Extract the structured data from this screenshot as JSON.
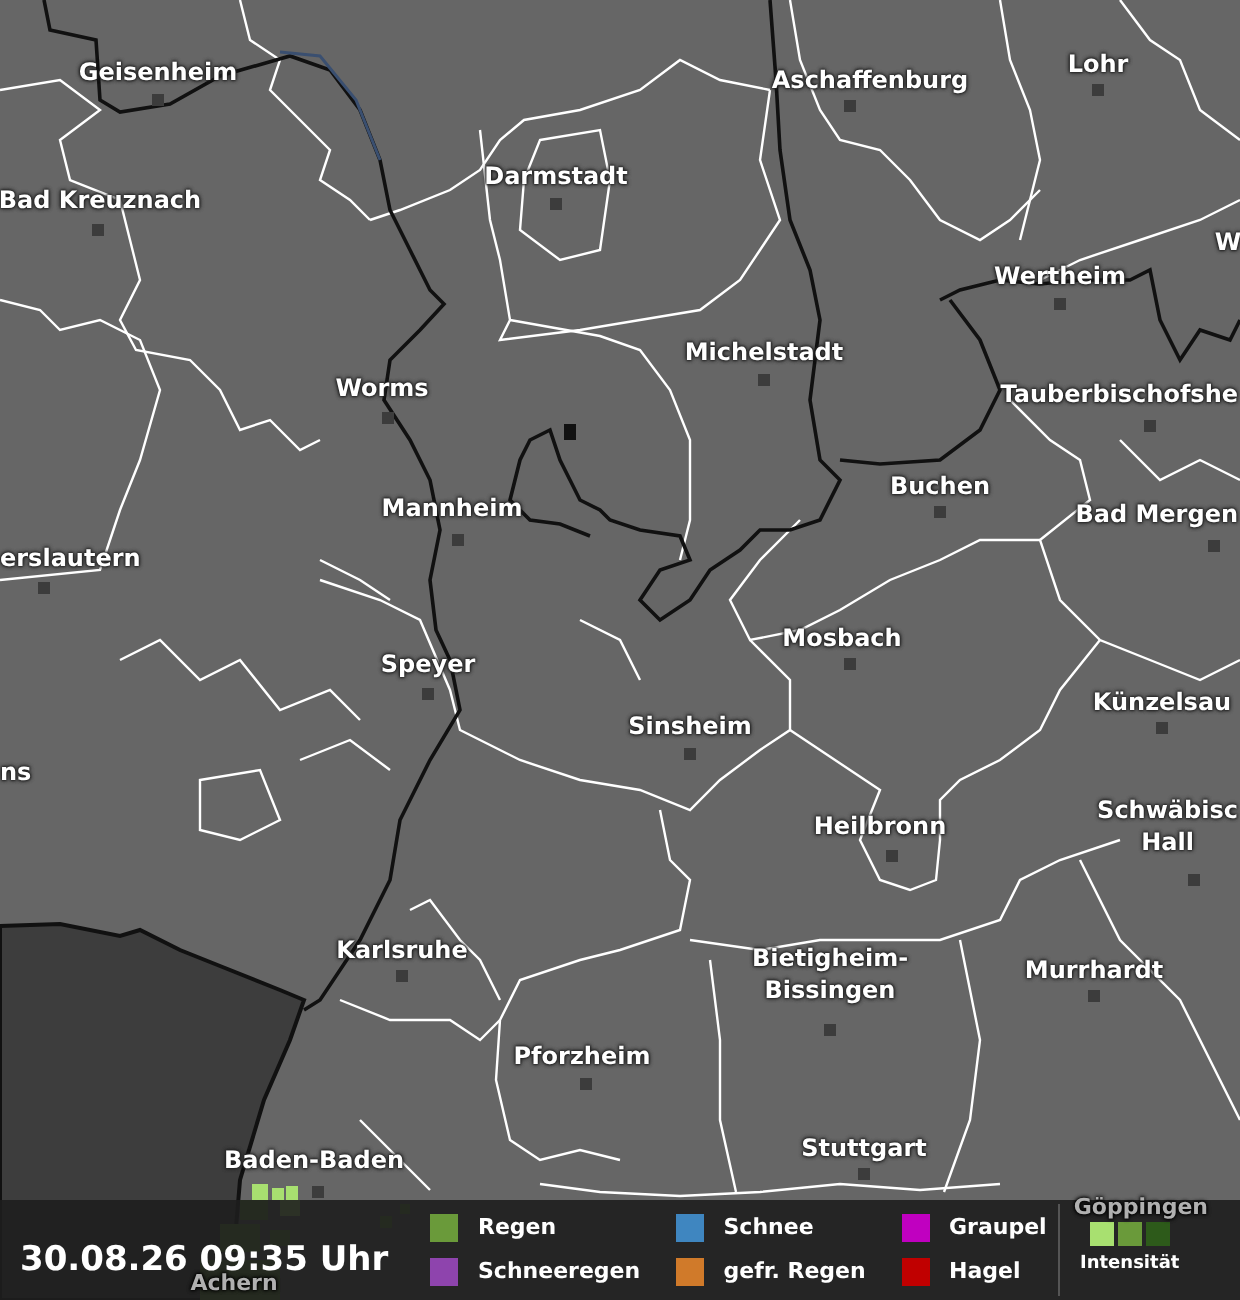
{
  "map": {
    "cities": [
      {
        "name": "Geisenheim"
      },
      {
        "name": "Bad Kreuznach"
      },
      {
        "name": "Darmstadt"
      },
      {
        "name": "Aschaffenburg"
      },
      {
        "name": "Lohr"
      },
      {
        "name": "W"
      },
      {
        "name": "Wertheim"
      },
      {
        "name": "Michelstadt"
      },
      {
        "name": "Worms"
      },
      {
        "name": "Tauberbischofshe"
      },
      {
        "name": "erslautern"
      },
      {
        "name": "Mannheim"
      },
      {
        "name": "Buchen"
      },
      {
        "name": "Bad Mergen"
      },
      {
        "name": "Mosbach"
      },
      {
        "name": "Speyer"
      },
      {
        "name": "Künzelsau"
      },
      {
        "name": "Sinsheim"
      },
      {
        "name": "ns"
      },
      {
        "name": "Heilbronn"
      },
      {
        "name": "Schwäbisc Hall"
      },
      {
        "name": "Karlsruhe"
      },
      {
        "name": "Bietigheim- Bissingen"
      },
      {
        "name": "Murrhardt"
      },
      {
        "name": "Pforzheim"
      },
      {
        "name": "Stuttgart"
      },
      {
        "name": "Baden-Baden"
      },
      {
        "name": "Göppingen"
      },
      {
        "name": "Achern"
      }
    ]
  },
  "footer": {
    "timestamp": "30.08.26 09:35 Uhr",
    "legend": [
      {
        "label": "Regen",
        "color": "#6a9a3a"
      },
      {
        "label": "Schneeregen",
        "color": "#8e44ad"
      },
      {
        "label": "Schnee",
        "color": "#3f86c0"
      },
      {
        "label": "gefr. Regen",
        "color": "#d07a2a"
      },
      {
        "label": "Graupel",
        "color": "#c000c0"
      },
      {
        "label": "Hagel",
        "color": "#c00000"
      }
    ],
    "intensity": {
      "label": "Intensität",
      "levels": [
        {
          "color": "#a8e070"
        },
        {
          "color": "#6a9a3a"
        },
        {
          "color": "#2d5a1a"
        }
      ]
    }
  }
}
